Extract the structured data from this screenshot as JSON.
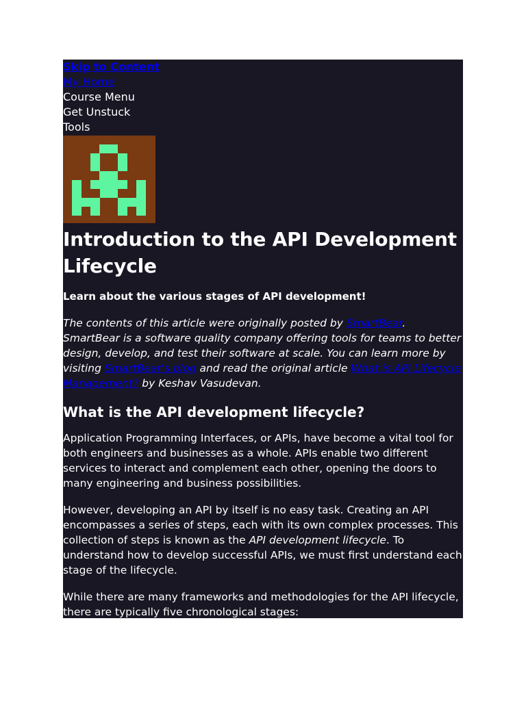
{
  "nav": {
    "skip_to_content": "Skip to Content",
    "my_home": "My Home",
    "course_menu": "Course Menu",
    "get_unstuck": "Get Unstuck",
    "tools": "Tools"
  },
  "colors": {
    "page_background": "#181723",
    "logo_background": "#7a3a12",
    "logo_foreground": "#5ef5a0",
    "link": "#0000ee"
  },
  "logo": {
    "icon": "pixel-figure-logo"
  },
  "article": {
    "title": "Introduction to the API Development Lifecycle",
    "subtitle": "Learn about the various stages of API development!",
    "intro": {
      "t1": "The contents of this article were originally posted by ",
      "link1": "SmartBear",
      "t2": ". SmartBear is a software quality company offering tools for teams to better design, develop, and test their software at scale. You can learn more by visiting ",
      "link2": "SmartBear's blog",
      "t3": " and read the original article ",
      "link3": "What is API Lifecycle Management?",
      "t4": " by Keshav Vasudevan."
    },
    "section_heading": "What is the API development lifecycle?",
    "p1": "Application Programming Interfaces, or APIs, have become a vital tool for both engineers and businesses as a whole. APIs enable two different services to interact and complement each other, opening the doors to many engineering and business possibilities.",
    "p2": {
      "t1": "However, developing an API by itself is no easy task. Creating an API encompasses a series of steps, each with its own complex processes. This collection of steps is known as the ",
      "em": "API development lifecycle",
      "t2": ". To understand how to develop successful APIs, we must first understand each stage of the lifecycle."
    },
    "p3": "While there are many frameworks and methodologies for the API lifecycle, there are typically five chronological stages:"
  }
}
